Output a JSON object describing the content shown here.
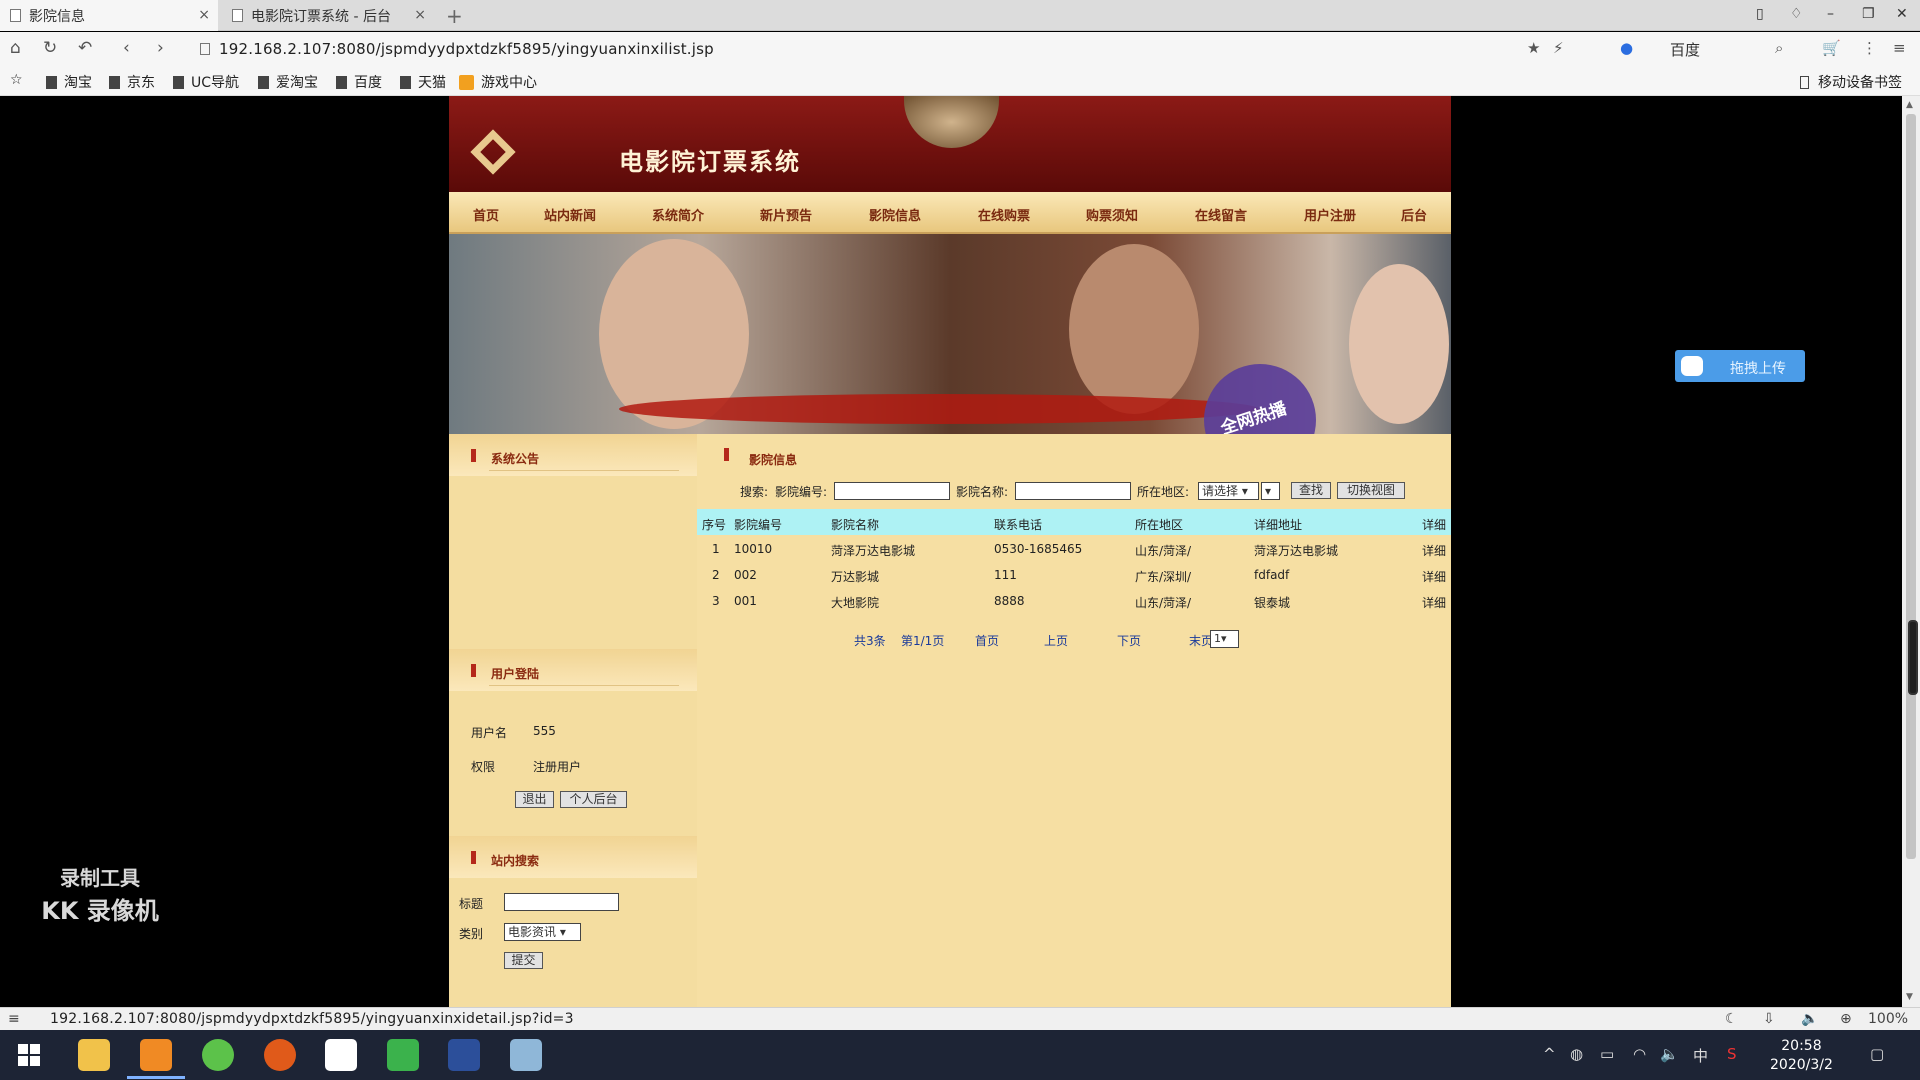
{
  "browser": {
    "tabs": [
      {
        "title": "影院信息",
        "active": true
      },
      {
        "title": "电影院订票系统 - 后台"
      }
    ],
    "url": "192.168.2.107:8080/jspmdyydpxtdzkf5895/yingyuanxinxilist.jsp",
    "search_engine": "百度",
    "bookmarks": [
      "淘宝",
      "京东",
      "UC导航",
      "爱淘宝",
      "百度",
      "天猫",
      "游戏中心"
    ],
    "mobile_bookmarks": "移动设备书签",
    "status_url": "192.168.2.107:8080/jspmdyydpxtdzkf5895/yingyuanxinxidetail.jsp?id=3",
    "zoom": "100%"
  },
  "site": {
    "title": "电影院订票系统",
    "menu": [
      "首页",
      "站内新闻",
      "系统简介",
      "新片预告",
      "影院信息",
      "在线购票",
      "购票须知",
      "在线留言",
      "用户注册",
      "后台"
    ],
    "banner_stamp": "全网热播"
  },
  "sidebar": {
    "announcement_title": "系统公告",
    "login_title": "用户登陆",
    "username_label": "用户名",
    "username_value": "555",
    "role_label": "权限",
    "role_value": "注册用户",
    "logout_btn": "退出",
    "personal_btn": "个人后台",
    "site_search_title": "站内搜索",
    "search_title_label": "标题",
    "search_title_value": "",
    "search_category_label": "类别",
    "search_category_value": "电影资讯",
    "submit_btn": "提交"
  },
  "main": {
    "section_title": "影院信息",
    "search_label": "搜索:",
    "cinema_no_label": "影院编号:",
    "cinema_no_value": "",
    "cinema_name_label": "影院名称:",
    "cinema_name_value": "",
    "region_label": "所在地区:",
    "region_value": "请选择",
    "search_btn": "查找",
    "switch_btn": "切换视图",
    "columns": [
      "序号",
      "影院编号",
      "影院名称",
      "联系电话",
      "所在地区",
      "详细地址",
      "详细"
    ],
    "rows": [
      {
        "idx": "1",
        "no": "10010",
        "name": "菏泽万达电影城",
        "phone": "0530-1685465",
        "region": "山东/菏泽/",
        "address": "菏泽万达电影城",
        "detail": "详细"
      },
      {
        "idx": "2",
        "no": "002",
        "name": "万达影城",
        "phone": "111",
        "region": "广东/深圳/",
        "address": "fdfadf",
        "detail": "详细"
      },
      {
        "idx": "3",
        "no": "001",
        "name": "大地影院",
        "phone": "8888",
        "region": "山东/菏泽/",
        "address": "银泰城",
        "detail": "详细"
      }
    ],
    "pager": {
      "total": "共3条",
      "page": "第1/1页",
      "first": "首页",
      "prev": "上页",
      "next": "下页",
      "last": "末页",
      "select": "1"
    }
  },
  "widgets": {
    "upload": "拖拽上传",
    "watermark_line1": "录制工具",
    "watermark_line2": "KK 录像机"
  },
  "taskbar": {
    "time": "20:58",
    "date": "2020/3/2",
    "ime": "中"
  }
}
